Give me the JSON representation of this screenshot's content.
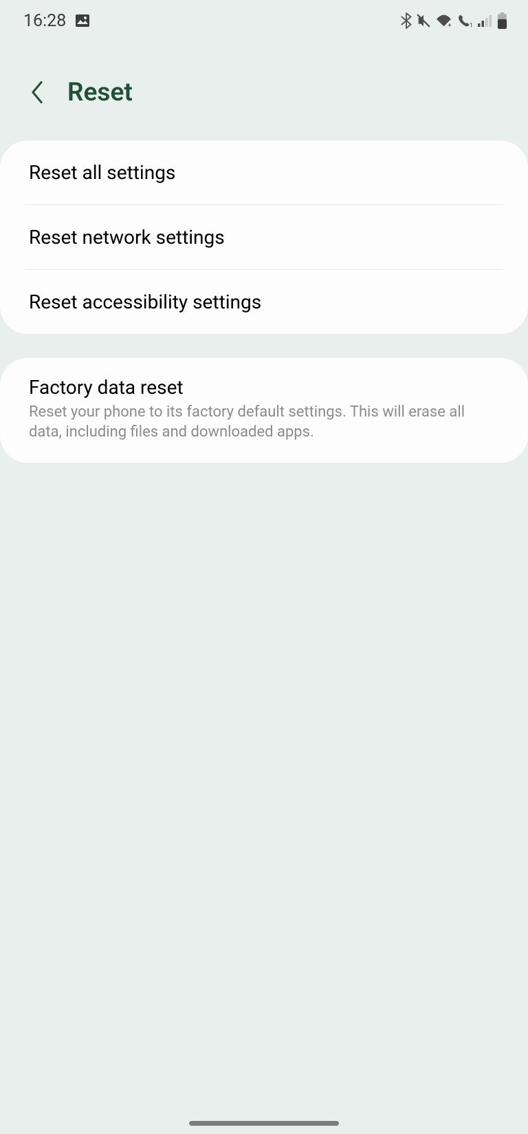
{
  "status": {
    "time": "16:28"
  },
  "header": {
    "title": "Reset"
  },
  "group1": {
    "items": [
      {
        "label": "Reset all settings"
      },
      {
        "label": "Reset network settings"
      },
      {
        "label": "Reset accessibility settings"
      }
    ]
  },
  "group2": {
    "title": "Factory data reset",
    "sub": "Reset your phone to its factory default settings. This will erase all data, including files and downloaded apps."
  }
}
